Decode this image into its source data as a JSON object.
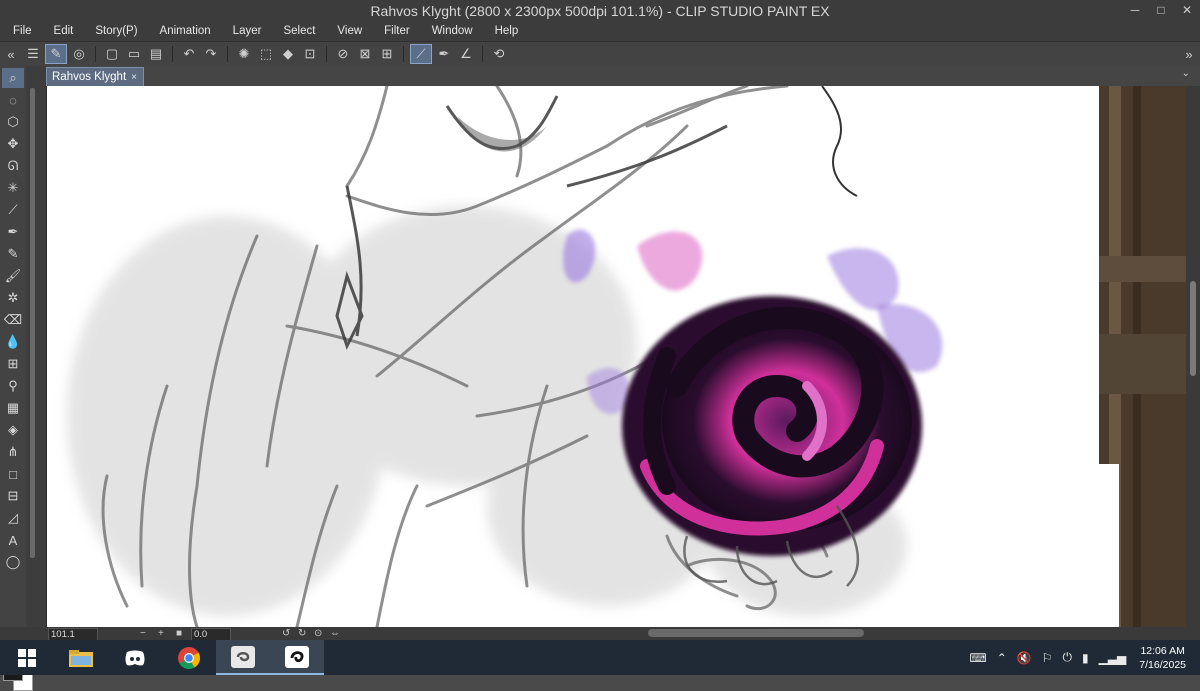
{
  "window": {
    "title": "Rahvos Klyght (2800 x 2300px 500dpi 101.1%) - CLIP STUDIO PAINT EX",
    "controls": [
      "─",
      "□",
      "✕"
    ]
  },
  "menu": [
    "File",
    "Edit",
    "Story(P)",
    "Animation",
    "Layer",
    "Select",
    "View",
    "Filter",
    "Window",
    "Help"
  ],
  "tabs": [
    {
      "label": "Rahvos Klyght",
      "close": "×"
    }
  ],
  "status": {
    "zoom": "101.1",
    "angle": "0.0"
  },
  "clock": {
    "time": "12:06 AM",
    "date": "7/16/2025"
  },
  "colors": {
    "orb_magenta": "#d0309a",
    "orb_dark": "#1a0a1e",
    "orb_violet": "#9b7ae0"
  }
}
